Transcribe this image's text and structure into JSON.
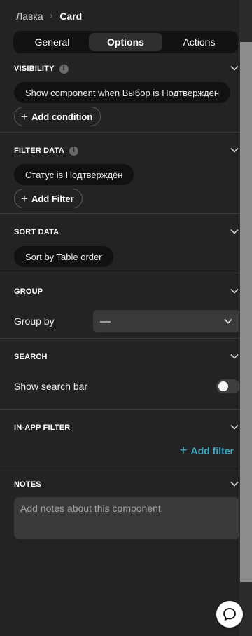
{
  "breadcrumb": {
    "parent": "Лавка",
    "current": "Card"
  },
  "tabs": [
    {
      "label": "General",
      "active": false
    },
    {
      "label": "Options",
      "active": true
    },
    {
      "label": "Actions",
      "active": false
    }
  ],
  "visibility": {
    "title": "VISIBILITY",
    "condition": "Show component when Выбор is Подтверждён",
    "add_label": "Add condition"
  },
  "filter_data": {
    "title": "FILTER DATA",
    "filter": "Статус is Подтверждён",
    "add_label": "Add Filter"
  },
  "sort_data": {
    "title": "SORT DATA",
    "sort": "Sort by Table order"
  },
  "group": {
    "title": "GROUP",
    "label": "Group by",
    "value": "—"
  },
  "search": {
    "title": "SEARCH",
    "label": "Show search bar",
    "enabled": false
  },
  "in_app_filter": {
    "title": "IN-APP FILTER",
    "add_label": "Add filter"
  },
  "notes": {
    "title": "NOTES",
    "placeholder": "Add notes about this component",
    "value": ""
  },
  "colors": {
    "background": "#232323",
    "accent": "#3ea9c9",
    "pill": "#111111",
    "input": "#3a3a3a"
  },
  "icons": {
    "info": "info-icon",
    "chevron": "chevron-down-icon",
    "breadcrumb_separator": "chevron-right-icon",
    "plus": "plus-icon",
    "chat": "chat-bubble-icon"
  }
}
